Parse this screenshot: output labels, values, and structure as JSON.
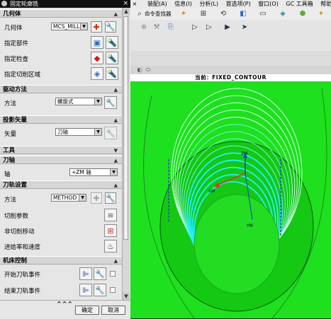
{
  "dialog": {
    "title": "固定轮廓铣",
    "close_label": "×",
    "sections": {
      "geometry": {
        "title": "几何体",
        "body_label": "几何体",
        "body_value": "MCS_MILL",
        "specify_part": "指定部件",
        "specify_check": "指定检查",
        "specify_cut_area": "指定切削区域"
      },
      "drive": {
        "title": "驱动方法",
        "method_label": "方法",
        "method_value": "螺旋式"
      },
      "projection": {
        "title": "投影矢量",
        "vector_label": "矢量",
        "vector_value": "刀轴"
      },
      "tool": {
        "title": "工具"
      },
      "tool_axis": {
        "title": "刀轴",
        "axis_label": "轴",
        "axis_value": "+ZM 轴"
      },
      "path_settings": {
        "title": "刀轨设置",
        "method_label": "方法",
        "method_value": "METHOD",
        "cut_params": "切削参数",
        "non_cut_moves": "非切削移动",
        "feeds_speeds": "进给率和速度"
      },
      "machine_control": {
        "title": "机床控制",
        "start_events": "开始刀轨事件",
        "end_events": "结束刀轨事件"
      }
    },
    "footer": {
      "more": "^^^",
      "ok": "确定",
      "cancel": "取消"
    }
  },
  "app": {
    "menu": [
      "×",
      "装配(A)",
      "信息(I)",
      "分析(L)",
      "首选项(P)",
      "窗口(O)",
      "GC 工具箱",
      "帮助"
    ],
    "command_finder": "命令查找器",
    "viewport_header": "当前：FIXED_CONTOUR",
    "axis_labels": {
      "zm": "ZM",
      "xm": "XM",
      "ym": "YM"
    }
  },
  "colors": {
    "viewport_bg": "#1fe01f",
    "toolpath": "#aef2c8",
    "accent": "#1f5fb5"
  }
}
